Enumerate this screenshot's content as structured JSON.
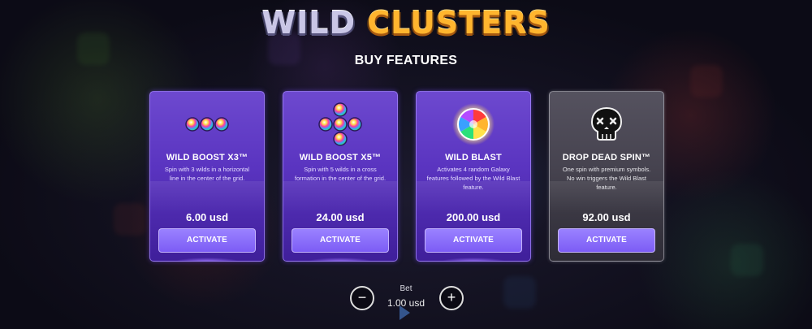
{
  "logo": {
    "word1": "WILD",
    "word2": "CLUSTERS"
  },
  "heading": "BUY FEATURES",
  "cards": [
    {
      "title": "WILD BOOST X3™",
      "description": "Spin with 3 wilds in a horizontal line in the center of the grid.",
      "price": "6.00 usd",
      "button": "ACTIVATE",
      "icon": "three-wild-orbs-icon"
    },
    {
      "title": "WILD BOOST X5™",
      "description": "Spin with 5 wilds in a cross formation in the center of the grid.",
      "price": "24.00 usd",
      "button": "ACTIVATE",
      "icon": "cross-wild-orbs-icon"
    },
    {
      "title": "WILD BLAST",
      "description": "Activates 4 random Galaxy features followed by the Wild Blast feature.",
      "price": "200.00 usd",
      "button": "ACTIVATE",
      "icon": "rainbow-orb-icon"
    },
    {
      "title": "DROP DEAD SPIN™",
      "description": "One spin with premium symbols. No win triggers the Wild Blast feature.",
      "price": "92.00 usd",
      "button": "ACTIVATE",
      "icon": "skull-icon"
    }
  ],
  "bet": {
    "label": "Bet",
    "value": "1.00 usd",
    "decrease_symbol": "−",
    "increase_symbol": "+"
  },
  "colors": {
    "card_purple": "#5a34c0",
    "card_grey": "#46434f",
    "button": "#8a6ffa",
    "logo_light": "#c9c6e6",
    "logo_orange": "#ffb52e"
  }
}
